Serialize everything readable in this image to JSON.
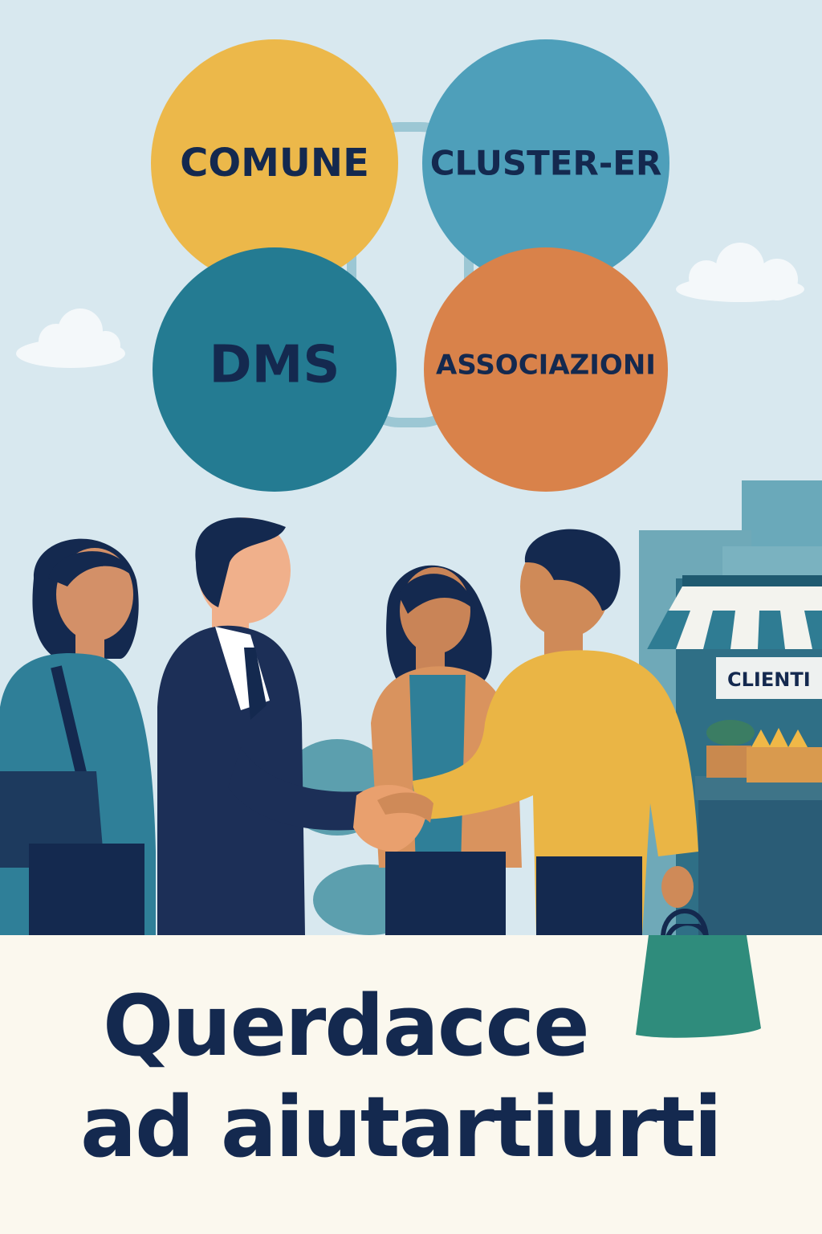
{
  "circles": {
    "top_left": "COMUNE",
    "top_right": "CLUSTER-ER",
    "bottom_left": "DMS",
    "bottom_right": "ASSOCIAZIONI"
  },
  "shop": {
    "sign": "CLIENTI"
  },
  "headline": {
    "line1": "Querdacce",
    "line2": "ad aiutartiurti"
  },
  "colors": {
    "sky": "#d8e8ef",
    "circle_yellow": "#ecb84a",
    "circle_blue": "#4e9fba",
    "circle_teal": "#247b92",
    "circle_orange": "#d9824a",
    "navy": "#14294f",
    "cream": "#fbf8ee"
  }
}
